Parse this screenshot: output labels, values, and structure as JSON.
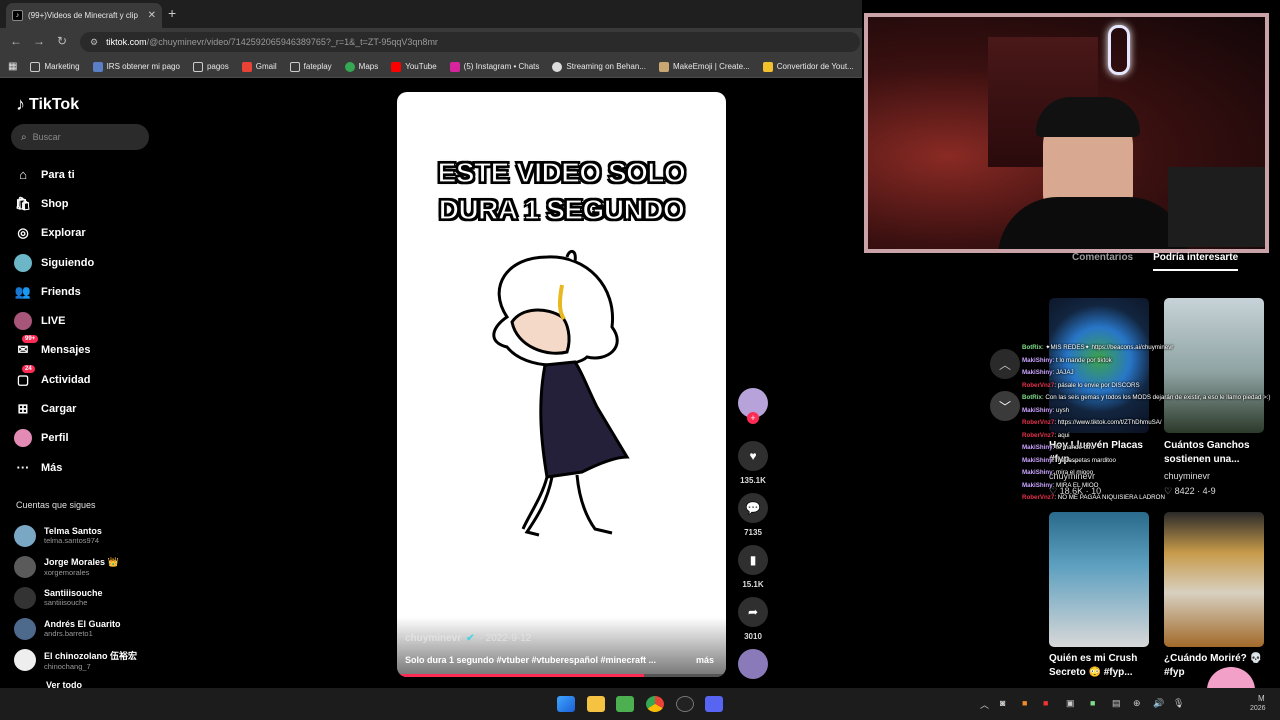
{
  "browser": {
    "tab_title": "(99+)Videos de Minecraft y clip",
    "tab_icon": "tiktok-icon",
    "url_host": "tiktok.com",
    "url_path": "/@chuyminevr/video/7142592065946389765?_r=1&_t=ZT-95qqV3qn8mr",
    "bookmarks": [
      "Marketing",
      "IRS obtener mi pago",
      "pagos",
      "Gmail",
      "fateplay",
      "Maps",
      "YouTube",
      "(5) Instagram • Chats",
      "Streaming on Behan...",
      "MakeEmoji | Create...",
      "Convertidor de Yout..."
    ]
  },
  "sidebar": {
    "logo": "TikTok",
    "search_placeholder": "Buscar",
    "nav": [
      {
        "label": "Para ti",
        "icon": "home-icon"
      },
      {
        "label": "Shop",
        "icon": "shop-icon"
      },
      {
        "label": "Explorar",
        "icon": "compass-icon"
      },
      {
        "label": "Siguiendo",
        "icon": "following-avatar-icon"
      },
      {
        "label": "Friends",
        "icon": "friends-icon"
      },
      {
        "label": "LIVE",
        "icon": "live-icon"
      },
      {
        "label": "Mensajes",
        "icon": "messages-icon",
        "badge": "99+"
      },
      {
        "label": "Actividad",
        "icon": "activity-icon",
        "badge": "24"
      },
      {
        "label": "Cargar",
        "icon": "upload-icon"
      },
      {
        "label": "Perfil",
        "icon": "profile-avatar-icon"
      },
      {
        "label": "Más",
        "icon": "more-icon"
      }
    ],
    "following_title": "Cuentas que sigues",
    "following": [
      {
        "name": "Telma Santos",
        "handle": "telma.santos974"
      },
      {
        "name": "Jorge Morales 👑",
        "handle": "xorgemorales"
      },
      {
        "name": "Santiiisouche",
        "handle": "santiiisouche"
      },
      {
        "name": "Andrés El Guarito",
        "handle": "andrs.barreto1"
      },
      {
        "name": "El chinozolano 伍裕宏",
        "handle": "chinochang_7"
      }
    ],
    "see_all": "Ver todo"
  },
  "video": {
    "title_line1": "ESTE VIDEO SOLO",
    "title_line2": "DURA 1 SEGUNDO",
    "author": "chuyminevr",
    "date": "· 2022-9-12",
    "description": "Solo dura 1 segundo #vtuber #vtuberespañol #minecraft ...",
    "more": "más",
    "progress": 0.75
  },
  "actions": {
    "likes": "135.1K",
    "comments": "7135",
    "saves": "15.1K",
    "shares": "3010"
  },
  "right_panel": {
    "tab_comments": "Comentarios",
    "tab_related": "Podría interesarte",
    "cards": [
      {
        "title": "Hoy Lluevén Placas #fyp...",
        "author": "chuyminevr",
        "likes": "18.6K",
        "date": "10"
      },
      {
        "title": "Cuántos Ganchos sostienen una...",
        "author": "chuyminevr",
        "likes": "8422",
        "date": "4-9"
      },
      {
        "title": "Quién es mi Crush Secreto 😳 #fyp..."
      },
      {
        "title": "¿Cuándo Moriré? 💀 #fyp"
      }
    ]
  },
  "chat": [
    {
      "user": "BotRix",
      "color": "green",
      "msg": ": ✦MIS REDES✦ https://beacons.ai/chuyminevr"
    },
    {
      "user": "MakiShiny",
      "color": "purple",
      "msg": ": t lo mande por tiktok"
    },
    {
      "user": "MakiShiny",
      "color": "purple",
      "msg": ": JAJAJ"
    },
    {
      "user": "RoberVnz7",
      "color": "red",
      "msg": ": pásale lo envie por DISCORS"
    },
    {
      "user": "BotRix",
      "color": "green",
      "msg": ": Con las seis gemas y todos los MODS dejarán de existir, a eso le llamo piedad >:)"
    },
    {
      "user": "MakiShiny",
      "color": "purple",
      "msg": ": uysh"
    },
    {
      "user": "RoberVnz7",
      "color": "red",
      "msg": ": https://www.tiktok.com/t/ZThDhmuSA/"
    },
    {
      "user": "RoberVnz7",
      "color": "red",
      "msg": ": aqui"
    },
    {
      "user": "MakiShiny",
      "color": "purple",
      "msg": ": te mande otro"
    },
    {
      "user": "MakiShiny",
      "color": "purple",
      "msg": ": me respetas marditoo"
    },
    {
      "user": "MakiShiny",
      "color": "purple",
      "msg": ": mira el miooo"
    },
    {
      "user": "MakiShiny",
      "color": "purple",
      "msg": ": MIRA EL MIOO"
    },
    {
      "user": "RoberVnz7",
      "color": "red",
      "msg": ": NO ME PAGAA NIQUISIERA LADRON"
    }
  ],
  "taskbar": {
    "time": "M",
    "date": "2026"
  }
}
